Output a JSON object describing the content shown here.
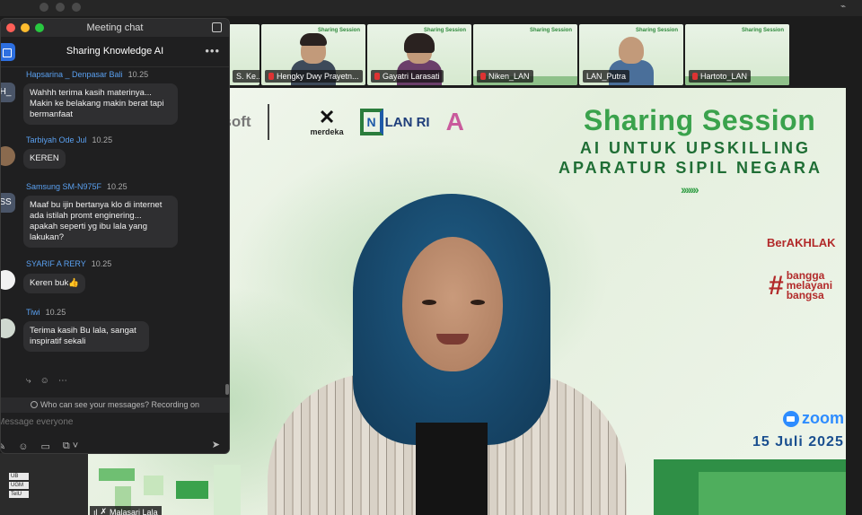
{
  "chat": {
    "window_title": "Meeting chat",
    "conversation": "Sharing Knowledge AI",
    "messages": [
      {
        "sender": "Hapsarina _ Denpasar Bali",
        "time": "10.25",
        "avatar": "H_",
        "text": "Wahhh terima kasih materinya...\nMakin ke belakang makin berat tapi\nbermanfaat"
      },
      {
        "sender": "Tarbiyah Ode Jul",
        "time": "10.25",
        "avatar": "",
        "text": "KEREN"
      },
      {
        "sender": "Samsung SM-N975F",
        "time": "10.25",
        "avatar": "SS",
        "text": "Maaf bu ijin bertanya klo di internet\nada istilah promt enginering...\napakah seperti yg ibu lala yang\nlakukan?"
      },
      {
        "sender": "SYARIF A RERY",
        "time": "10.25",
        "avatar": "",
        "text": "Keren buk👍"
      },
      {
        "sender": "Tiwi",
        "time": "10.25",
        "avatar": "",
        "text": "Terima kasih Bu lala, sangat\ninspiratif sekali"
      }
    ],
    "notice": "Who can see your messages? Recording on",
    "input_placeholder": "Message everyone"
  },
  "participants": [
    {
      "name": "S. Ke..."
    },
    {
      "name": "Hengky Dwy Prayetn..."
    },
    {
      "name": "Gayatri Larasati"
    },
    {
      "name": "Niken_LAN"
    },
    {
      "name": "LAN_Putra"
    },
    {
      "name": "Hartoto_LAN"
    }
  ],
  "slide": {
    "title": "Sharing Session",
    "subtitle_line1": "AI UNTUK UPSKILLING",
    "subtitle_line2": "APARATUR SIPIL NEGARA",
    "logos": {
      "microsoft": "osoft",
      "merdeka": "merdeka",
      "lan": "LAN RI"
    },
    "berakhlak": "BerAKHLAK",
    "bangga_line1": "bangga",
    "bangga_line2": "melayani",
    "bangga_line3": "bangsa",
    "zoom": "zoom",
    "date": "15 Juli 2025"
  },
  "speaker": {
    "name": "Malasari Lala"
  },
  "side_list": [
    "UB",
    "UGM",
    "TelU"
  ],
  "colors": {
    "accent_green": "#3aa24c",
    "dark_green": "#1f6e35",
    "zoom_blue": "#2d8cff",
    "chat_bg": "#1f1f20"
  }
}
